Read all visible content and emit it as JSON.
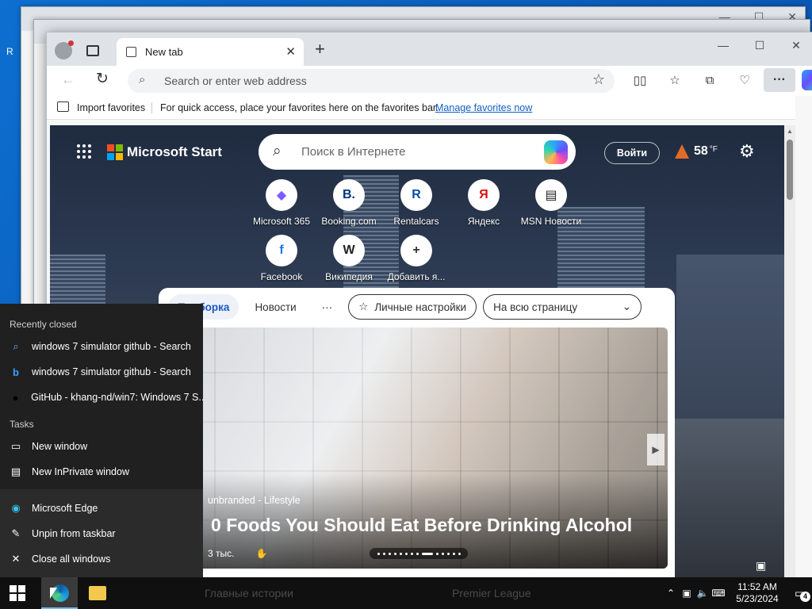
{
  "desktop": {
    "left_letter": "R"
  },
  "browser": {
    "tab": {
      "title": "New tab",
      "close": "✕"
    },
    "new_tab_glyph": "+",
    "window_controls": {
      "minimize": "—",
      "maximize": "☐",
      "close": "✕"
    },
    "address": {
      "placeholder": "Search or enter web address"
    },
    "more_glyph": "···",
    "favorites_bar": {
      "import_label": "Import favorites",
      "message": "For quick access, place your favorites here on the favorites bar.",
      "manage_link": "Manage favorites now"
    }
  },
  "msn": {
    "brand": "Microsoft Start",
    "search_placeholder": "Поиск в Интернете",
    "login": "Войти",
    "weather": {
      "temp": "58",
      "unit": "°F"
    },
    "quick_links": [
      {
        "label": "Microsoft 365",
        "icon": "microsoft-365-icon",
        "glyph": "◆",
        "color": "#7b5cff"
      },
      {
        "label": "Booking.com",
        "icon": "booking-icon",
        "glyph": "B.",
        "color": "#003580"
      },
      {
        "label": "Rentalcars",
        "icon": "rentalcars-icon",
        "glyph": "R",
        "color": "#0a4ca8"
      },
      {
        "label": "Яндекс",
        "icon": "yandex-icon",
        "glyph": "Я",
        "color": "#d11"
      },
      {
        "label": "MSN Новости",
        "icon": "msn-news-icon",
        "glyph": "▤",
        "color": "#222"
      },
      {
        "label": "Facebook",
        "icon": "facebook-icon",
        "glyph": "f",
        "color": "#1877f2"
      },
      {
        "label": "Википедия",
        "icon": "wikipedia-icon",
        "glyph": "W",
        "color": "#222"
      },
      {
        "label": "Добавить я...",
        "icon": "add-icon",
        "glyph": "+",
        "color": "#333"
      }
    ],
    "feed": {
      "tabs": [
        "Подборка",
        "Новости"
      ],
      "more": "···",
      "personalize": "Личные настройки",
      "layout_select": "На всю страницу",
      "article": {
        "source": "unbranded - Lifestyle",
        "title": "Foods You Should Eat Before Drinking Alcohol",
        "title_prefix": "0",
        "likes": "3 тыс."
      }
    }
  },
  "jump_list": {
    "recently_closed_header": "Recently closed",
    "recent": [
      {
        "label": "windows 7 simulator github - Search",
        "icon": "search-icon"
      },
      {
        "label": "windows 7 simulator github - Search",
        "icon": "bing-icon"
      },
      {
        "label": "GitHub - khang-nd/win7: Windows 7 S...",
        "icon": "github-icon"
      }
    ],
    "tasks_header": "Tasks",
    "tasks": [
      {
        "label": "New window",
        "icon": "window-icon"
      },
      {
        "label": "New InPrivate window",
        "icon": "inprivate-icon"
      }
    ],
    "app": [
      {
        "label": "Microsoft Edge",
        "icon": "edge-icon"
      },
      {
        "label": "Unpin from taskbar",
        "icon": "unpin-icon"
      },
      {
        "label": "Close all windows",
        "icon": "close-icon"
      }
    ]
  },
  "taskbar": {
    "ghost_items": [
      "Главные истории",
      "Premier League"
    ],
    "clock_time": "11:52 AM",
    "clock_date": "5/23/2024",
    "notification_count": "4"
  }
}
